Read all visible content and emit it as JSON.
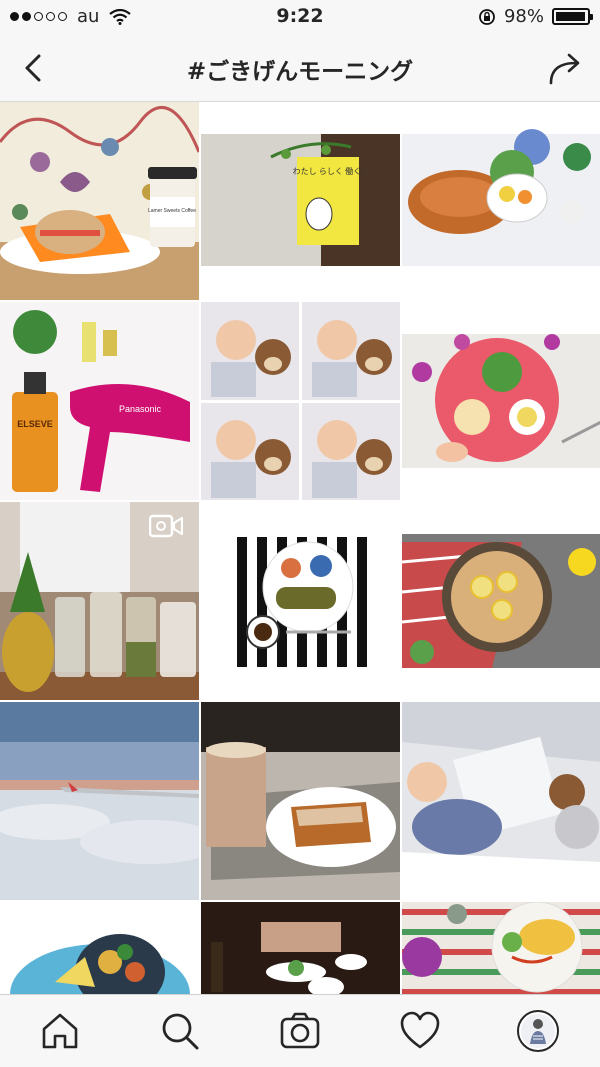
{
  "status_bar": {
    "carrier": "au",
    "time": "9:22",
    "battery": "98%",
    "battery_level": 0.98
  },
  "header": {
    "title": "#ごきげんモーニング"
  },
  "tabs": [
    {
      "name": "home-tab",
      "icon": "home-icon"
    },
    {
      "name": "search-tab",
      "icon": "search-icon"
    },
    {
      "name": "camera-tab",
      "icon": "camera-icon"
    },
    {
      "name": "activity-tab",
      "icon": "heart-icon"
    },
    {
      "name": "profile-tab",
      "icon": "avatar"
    }
  ],
  "posts": [
    {
      "caption": "Bagel and coffee",
      "badge_text": "Lamer Sweets Coffee"
    },
    {
      "caption": "Book",
      "book_title": "わたし らしく 働く!"
    },
    {
      "caption": "Bread and fruit breakfast"
    },
    {
      "caption": "Hair oil and pink hair dryer",
      "brand": "Panasonic",
      "product": "ELSEVE"
    },
    {
      "caption": "Baby with monkey plush collage"
    },
    {
      "caption": "Pink plate breakfast"
    },
    {
      "caption": "Kitchen jars and pineapple video",
      "is_video": true
    },
    {
      "caption": "Striped placemat breakfast"
    },
    {
      "caption": "Dutch baby with lemon"
    },
    {
      "caption": "Sky above clouds"
    },
    {
      "caption": "Latte and french toast"
    },
    {
      "caption": "Baby sleeping in crib"
    },
    {
      "caption": "Bowl breakfast"
    },
    {
      "caption": "Cafe table"
    },
    {
      "caption": "Flower and omelette plate"
    }
  ]
}
